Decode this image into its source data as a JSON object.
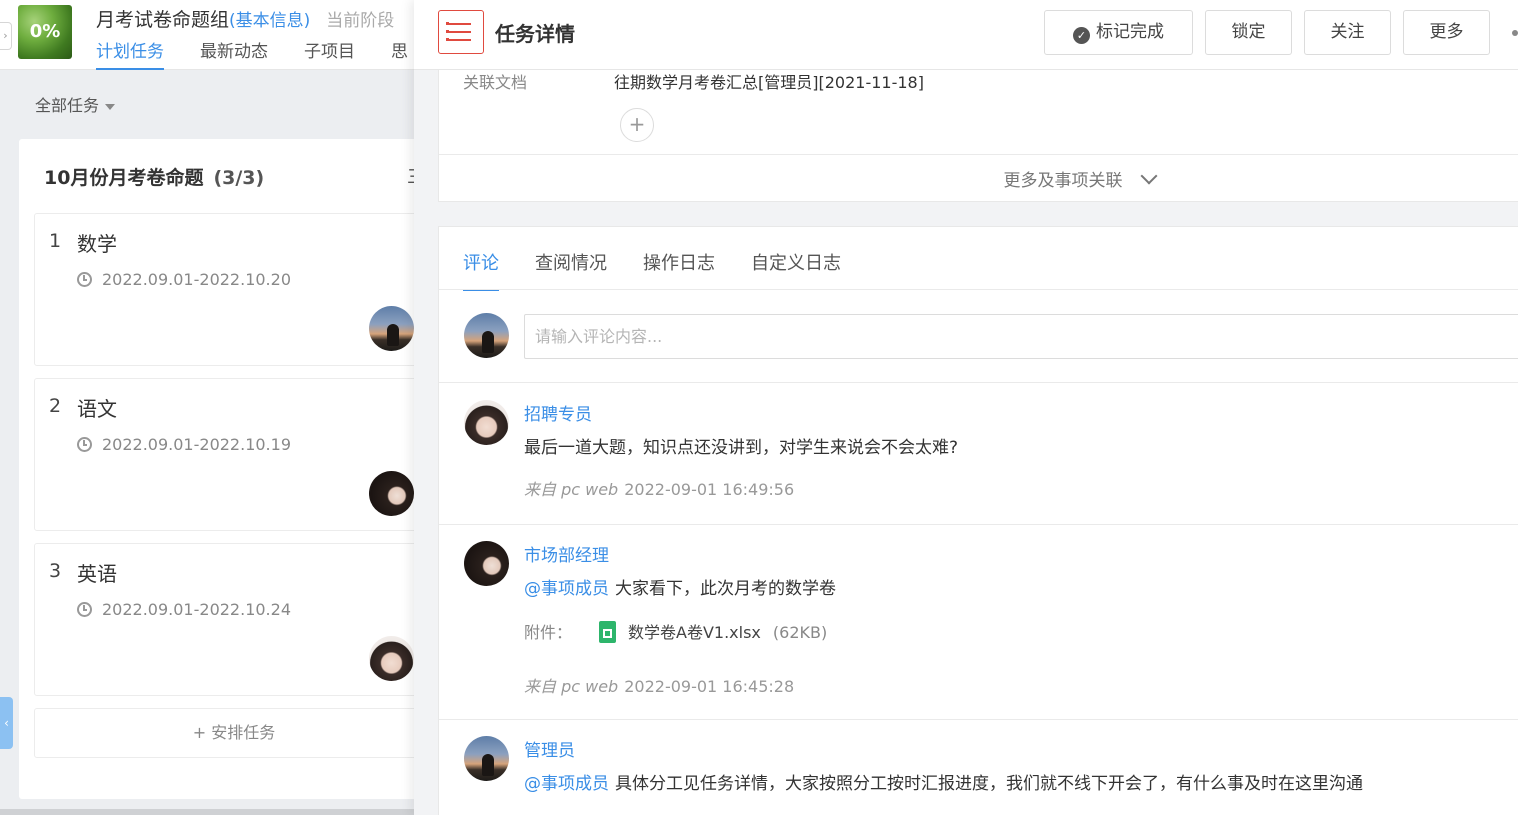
{
  "project": {
    "progress": "0%",
    "name": "月考试卷命题组",
    "basic_info_link": "(基本信息)",
    "stage_label": "当前阶段",
    "tabs": [
      "计划任务",
      "最新动态",
      "子项目",
      "思"
    ]
  },
  "filter": {
    "label": "全部任务"
  },
  "board": {
    "title": "10月份月考卷命题",
    "count": "(3/3)",
    "menu_glyph": "三",
    "tasks": [
      {
        "num": "1",
        "name": "数学",
        "date": "2022.09.01-2022.10.20"
      },
      {
        "num": "2",
        "name": "语文",
        "date": "2022.09.01-2022.10.19"
      },
      {
        "num": "3",
        "name": "英语",
        "date": "2022.09.01-2022.10.24"
      }
    ],
    "add_task": "+ 安排任务"
  },
  "detail": {
    "title": "任务详情",
    "buttons": {
      "mark_done": "标记完成",
      "lock": "锁定",
      "follow": "关注",
      "more": "更多"
    },
    "related_label": "关联文档",
    "related_value": "往期数学月考卷汇总[管理员][2021-11-18]",
    "add_glyph": "+",
    "more_related": "更多及事项关联"
  },
  "comments_panel": {
    "tabs": [
      "评论",
      "查阅情况",
      "操作日志",
      "自定义日志"
    ],
    "input_placeholder": "请输入评论内容...",
    "attach_label": "附件：",
    "comments": [
      {
        "author": "招聘专员",
        "mention": "",
        "text": "最后一道大题，知识点还没讲到，对学生来说会不会太难?",
        "source": "来自 pc web",
        "time": "2022-09-01 16:49:56"
      },
      {
        "author": "市场部经理",
        "mention": "@事项成员",
        "text": "大家看下，此次月考的数学卷",
        "attachment": {
          "name": "数学卷A卷V1.xlsx",
          "size": "(62KB)"
        },
        "source": "来自 pc web",
        "time": "2022-09-01 16:45:28"
      },
      {
        "author": "管理员",
        "mention": "@事项成员",
        "text": "具体分工见任务详情，大家按照分工按时汇报进度，我们就不线下开会了，有什么事及时在这里沟通"
      }
    ]
  },
  "colors": {
    "accent": "#3a8ee6",
    "danger": "#e04a3f",
    "excel": "#2db56b"
  }
}
